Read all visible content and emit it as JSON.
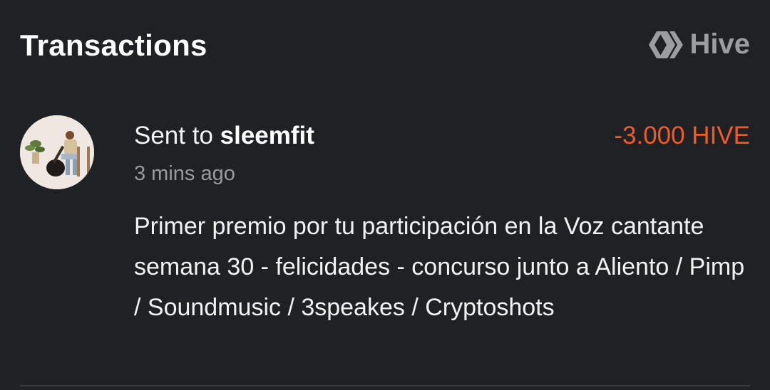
{
  "header": {
    "title": "Transactions",
    "brand": "Hive"
  },
  "transaction": {
    "summary_prefix": "Sent to ",
    "recipient": "sleemfit",
    "amount": "-3.000 HIVE",
    "time": "3 mins ago",
    "memo": "Primer premio por tu participación en la Voz cantante semana 30 - felicidades - concurso junto a Aliento / Pimp / Soundmusic / 3speakes / Cryptoshots"
  },
  "colors": {
    "background": "#1f2124",
    "negative_amount": "#ef5b2b",
    "muted_text": "#9a9a9a"
  },
  "icons": {
    "brand": "hive-logo-icon",
    "avatar": "user-avatar"
  }
}
